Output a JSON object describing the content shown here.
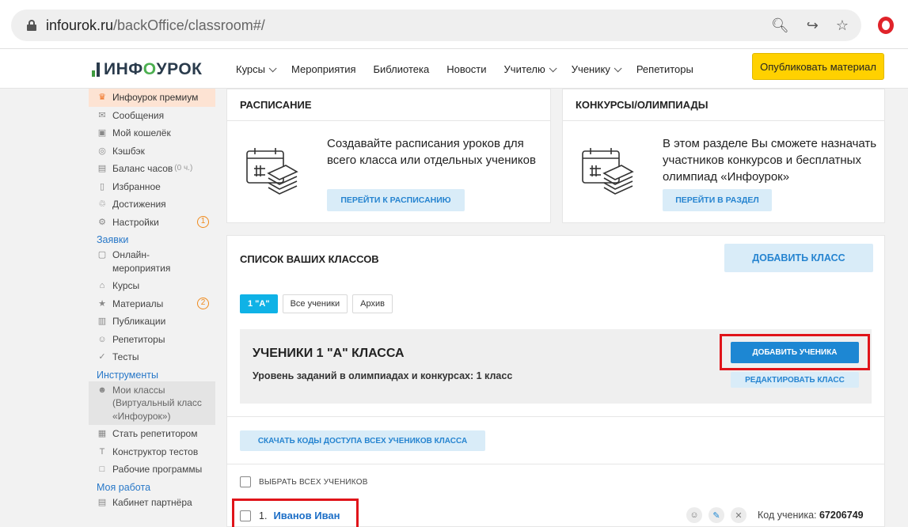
{
  "browser": {
    "url_domain": "infourok.ru",
    "url_path": "/backOffice/classroom#/"
  },
  "header": {
    "logo_part1": "ИНФ",
    "logo_o": "О",
    "logo_part2": "УРОК",
    "nav": [
      "Курсы",
      "Мероприятия",
      "Библиотека",
      "Новости",
      "Учителю",
      "Ученику",
      "Репетиторы"
    ],
    "publish_label": "Опубликовать материал"
  },
  "sidebar": {
    "premium": "Инфоурок премиум",
    "messages": "Сообщения",
    "wallet": "Мой кошелёк",
    "cashback": "Кэшбэк",
    "hours_balance": "Баланс часов",
    "hours_value": "(0 ч.)",
    "favorites": "Избранное",
    "achievements": "Достижения",
    "settings": "Настройки",
    "settings_badge": "1",
    "section_requests": "Заявки",
    "online_events": "Онлайн-мероприятия",
    "courses": "Курсы",
    "materials": "Материалы",
    "materials_badge": "2",
    "publications": "Публикации",
    "tutors": "Репетиторы",
    "tests": "Тесты",
    "section_tools": "Инструменты",
    "my_classes": "Мои классы (Виртуальный класс «Инфоурок»)",
    "become_tutor": "Стать репетитором",
    "test_builder": "Конструктор тестов",
    "work_programs": "Рабочие программы",
    "section_my_work": "Моя работа",
    "partner_cabinet": "Кабинет партнёра"
  },
  "schedule": {
    "title": "РАСПИСАНИЕ",
    "text": "Создавайте расписания уроков для всего класса или отдельных учеников",
    "button": "ПЕРЕЙТИ К РАСПИСАНИЮ"
  },
  "contests": {
    "title": "КОНКУРСЫ/ОЛИМПИАДЫ",
    "text": "В этом разделе Вы сможете назначать участников конкурсов и бесплатных олимпиад «Инфоурок»",
    "button": "ПЕРЕЙТИ В РАЗДЕЛ"
  },
  "classes": {
    "title": "СПИСОК ВАШИХ КЛАССОВ",
    "add_class": "ДОБАВИТЬ КЛАСС",
    "tabs": [
      "1 \"А\"",
      "Все ученики",
      "Архив"
    ],
    "class_heading": "УЧЕНИКИ 1 \"А\" КЛАССА",
    "level_text": "Уровень заданий в олимпиадах и конкурсах: 1 класс",
    "add_student": "ДОБАВИТЬ УЧЕНИКА",
    "edit_class": "РЕДАКТИРОВАТЬ КЛАСС",
    "download_codes": "СКАЧАТЬ КОДЫ ДОСТУПА ВСЕХ УЧЕНИКОВ КЛАССА",
    "select_all": "ВЫБРАТЬ ВСЕХ УЧЕНИКОВ",
    "students": [
      {
        "number": "1.",
        "name": "Иванов Иван",
        "code_label": "Код ученика:",
        "code": "67206749"
      }
    ]
  },
  "colors": {
    "accent": "#1d87d3",
    "publish": "#ffd100",
    "highlight_frame": "#e0141a",
    "tab_active": "#0fb2e6"
  }
}
